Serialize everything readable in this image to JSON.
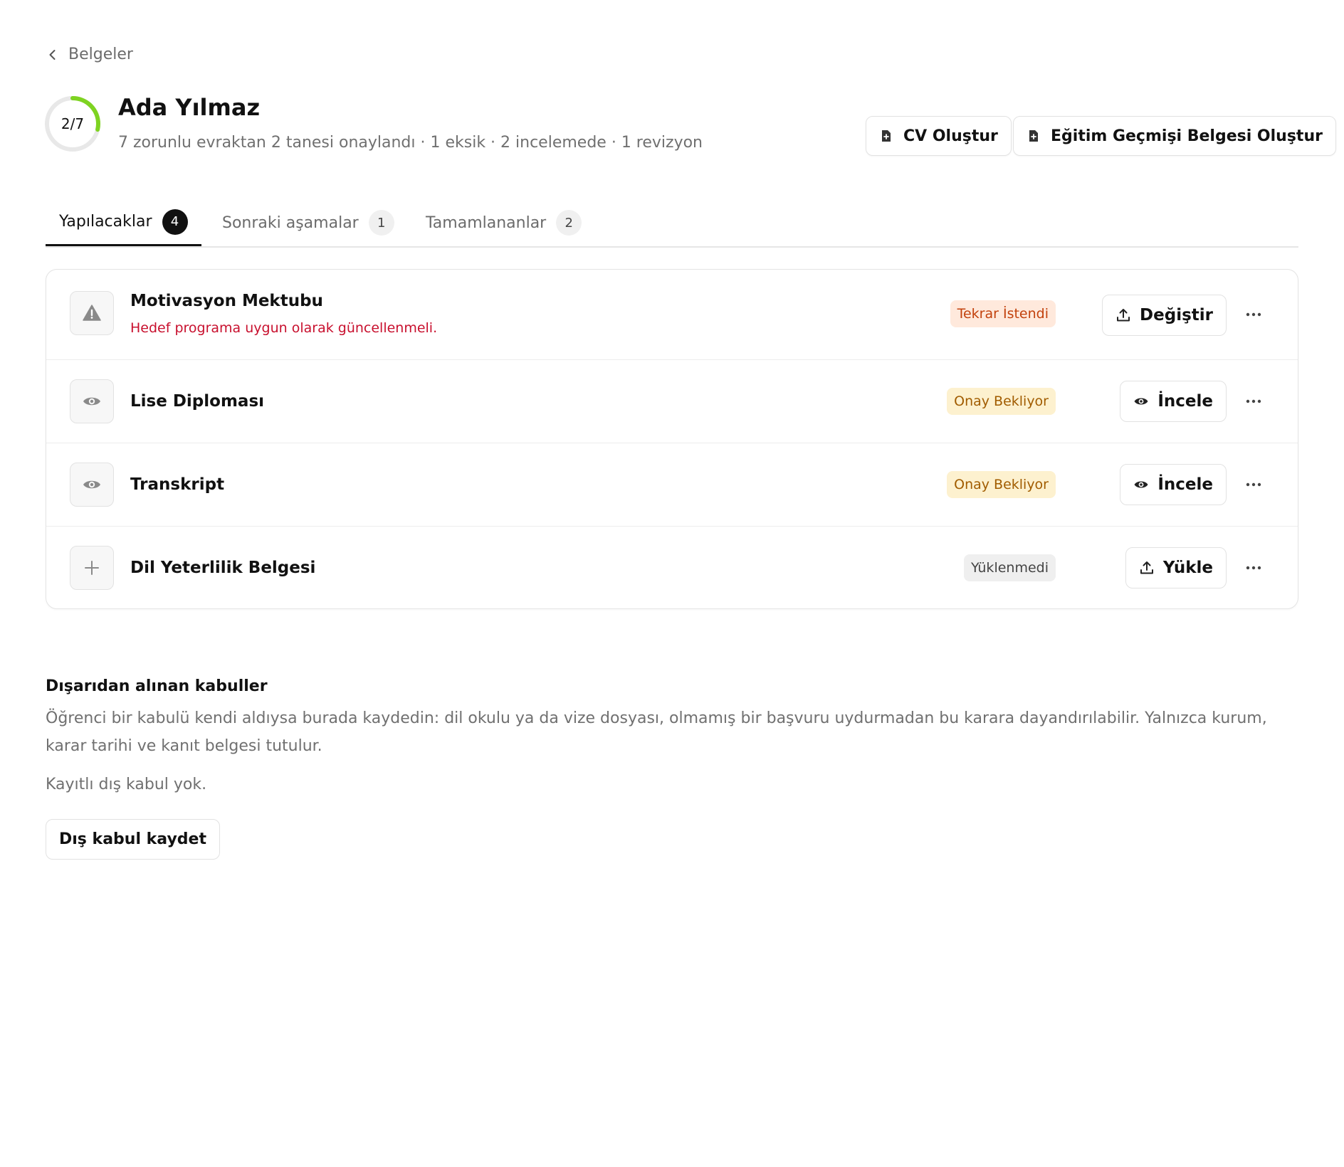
{
  "nav": {
    "back_label": "Belgeler"
  },
  "student": {
    "name": "Ada Yılmaz",
    "progress_label": "2/7",
    "progress_fraction": 0.2857,
    "summary": "7 zorunlu evraktan 2 tanesi onaylandı · 1 eksik · 2 incelemede · 1 revizyon"
  },
  "actions": {
    "cv_label": "CV Oluştur",
    "education_label": "Eğitim Geçmişi Belgesi Oluştur"
  },
  "tabs": [
    {
      "label": "Yapılacaklar",
      "count": "4"
    },
    {
      "label": "Sonraki aşamalar",
      "count": "1"
    },
    {
      "label": "Tamamlananlar",
      "count": "2"
    }
  ],
  "documents": [
    {
      "title": "Motivasyon Mektubu",
      "note": "Hedef programa uygun olarak güncellenmeli.",
      "status": "Tekrar İstendi",
      "status_icon": "warning-icon",
      "action_label": "Değiştir",
      "action_icon": "upload-icon"
    },
    {
      "title": "Lise Diploması",
      "status": "Onay Bekliyor",
      "status_icon": "eye-icon",
      "action_label": "İncele",
      "action_icon": "eye-icon"
    },
    {
      "title": "Transkript",
      "status": "Onay Bekliyor",
      "status_icon": "eye-icon",
      "action_label": "İncele",
      "action_icon": "eye-icon"
    },
    {
      "title": "Dil Yeterlilik Belgesi",
      "status": "Yüklenmedi",
      "status_icon": "plus-icon",
      "action_label": "Yükle",
      "action_icon": "upload-icon"
    }
  ],
  "external": {
    "title": "Dışarıdan alınan kabuller",
    "description": "Öğrenci bir kabulü kendi aldıysa burada kaydedin: dil okulu ya da vize dosyası, olmamış bir başvuru uydurmadan bu karara dayandırılabilir. Yalnızca kurum, karar tarihi ve kanıt belgesi tutulur.",
    "empty_text": "Kayıtlı dış kabul yok.",
    "button_label": "Dış kabul kaydet"
  },
  "colors": {
    "progress_ring": "#7ed321",
    "ring_track": "#e8e8e8",
    "danger_text": "#c8102e",
    "badge_revision_bg": "#ffe9dc",
    "badge_revision_text": "#c2410c",
    "badge_pending_bg": "#fdf1cf",
    "badge_pending_text": "#a15c00",
    "badge_missing_bg": "#efefef",
    "badge_missing_text": "#444444"
  }
}
